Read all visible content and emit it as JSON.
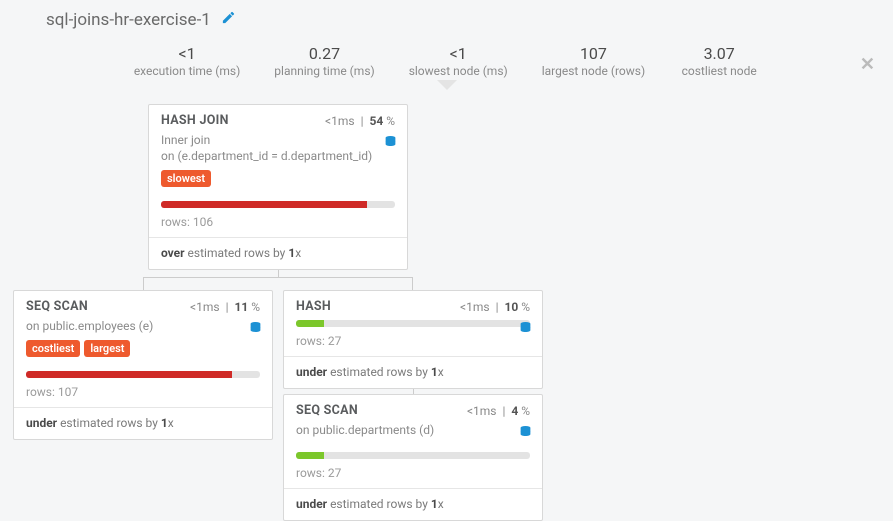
{
  "header": {
    "title": "sql-joins-hr-exercise-1"
  },
  "stats": {
    "exec_time": {
      "value": "<1",
      "label": "execution time (ms)"
    },
    "plan_time": {
      "value": "0.27",
      "label": "planning time (ms)"
    },
    "slow_node": {
      "value": "<1",
      "label": "slowest node (ms)"
    },
    "largest": {
      "value": "107",
      "label": "largest node (rows)"
    },
    "costliest": {
      "value": "3.07",
      "label": "costliest node"
    }
  },
  "nodes": {
    "hash_join": {
      "title": "HASH JOIN",
      "time": "<1",
      "unit": "ms",
      "pct": "54",
      "desc1": "Inner",
      "desc1b": "join",
      "desc2": "on",
      "desc2b": "(e.department_id = d.department_id)",
      "tags": [
        "slowest"
      ],
      "bar_pct": 88,
      "rows_label": "rows:",
      "rows": "106",
      "est_prefix": "over",
      "est_mid": "estimated rows by",
      "est_factor": "1",
      "est_suffix": "x"
    },
    "seq_emp": {
      "title": "SEQ SCAN",
      "time": "<1",
      "unit": "ms",
      "pct": "11",
      "desc2": "on",
      "desc2b": "public.employees (e)",
      "tags": [
        "costliest",
        "largest"
      ],
      "bar_pct": 88,
      "rows_label": "rows:",
      "rows": "107",
      "est_prefix": "under",
      "est_mid": "estimated rows by",
      "est_factor": "1",
      "est_suffix": "x"
    },
    "hash": {
      "title": "HASH",
      "time": "<1",
      "unit": "ms",
      "pct": "10",
      "bar_pct": 12,
      "rows_label": "rows:",
      "rows": "27",
      "est_prefix": "under",
      "est_mid": "estimated rows by",
      "est_factor": "1",
      "est_suffix": "x"
    },
    "seq_dep": {
      "title": "SEQ SCAN",
      "time": "<1",
      "unit": "ms",
      "pct": "4",
      "desc2": "on",
      "desc2b": "public.departments (d)",
      "bar_pct": 12,
      "rows_label": "rows:",
      "rows": "27",
      "est_prefix": "under",
      "est_mid": "estimated rows by",
      "est_factor": "1",
      "est_suffix": "x"
    }
  }
}
